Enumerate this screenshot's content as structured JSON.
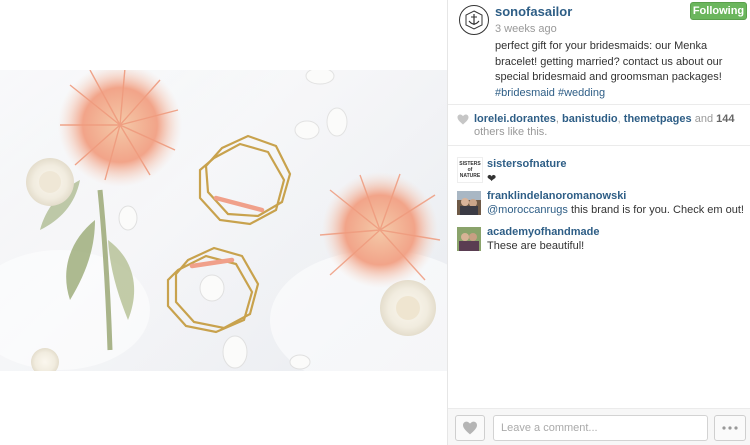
{
  "post": {
    "username": "sonofasailor",
    "time_ago": "3 weeks ago",
    "follow_label": "Following",
    "caption_text": "perfect gift for your bridesmaids: our Menka bracelet! getting married? contact us about our special bridesmaid and groomsman packages!",
    "hashtags": [
      "#bridesmaid",
      "#wedding"
    ]
  },
  "likes": {
    "users": [
      "lorelei.dorantes",
      "banistudio",
      "themetpages"
    ],
    "and_text": "and",
    "count": "144",
    "suffix": "others like this."
  },
  "comments": [
    {
      "username": "sistersofnature",
      "text": "❤",
      "avatar_text": "SISTERS of NATURE"
    },
    {
      "username": "franklindelanoromanowski",
      "mention": "@moroccanrugs",
      "text": "this brand is for you. Check em out!"
    },
    {
      "username": "academyofhandmade",
      "text": "These are beautiful!"
    }
  ],
  "footer": {
    "comment_placeholder": "Leave a comment..."
  },
  "colors": {
    "link": "#2e5e86",
    "follow_green": "#6bb65d"
  },
  "icons": {
    "like": "heart-icon",
    "more": "ellipsis-icon",
    "avatar": "anchor-logo-icon"
  }
}
